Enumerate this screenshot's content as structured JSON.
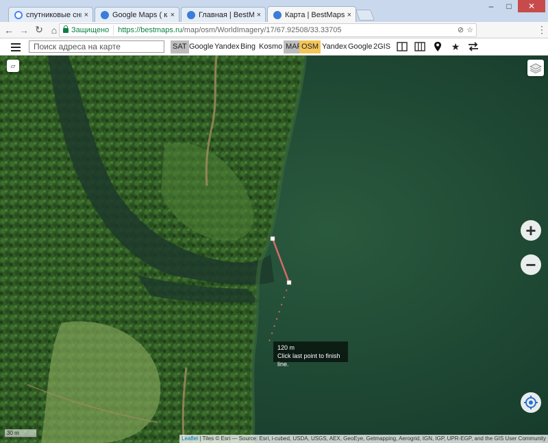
{
  "browser": {
    "tabs": [
      {
        "title": "спутниковые снимки - Г",
        "favicon_color": "#4285f4",
        "active": false
      },
      {
        "title": "Google Maps ( карты Go",
        "favicon_color": "#3b7dd8",
        "active": false
      },
      {
        "title": "Главная | BestMaps - спу",
        "favicon_color": "#3b7dd8",
        "active": false
      },
      {
        "title": "Карта | BestMaps - спут",
        "favicon_color": "#3b7dd8",
        "active": true
      }
    ],
    "close_glyph": "×",
    "secure_label": "Защищено",
    "url_host": "https://bestmaps.ru",
    "url_path": "/map/osm/WorldImagery/17/67.92508/33.33705"
  },
  "toolbar": {
    "search_placeholder": "Поиск адреса на карте",
    "sat_label": "SAT",
    "sat_providers": [
      "Google",
      "Yandex",
      "Bing",
      "Kosmo"
    ],
    "map_label": "MAP",
    "map_providers": [
      "OSM",
      "Yandex",
      "Google",
      "2GIS"
    ]
  },
  "map": {
    "measure_distance": "120 m",
    "measure_hint": "Click last point to finish line.",
    "scale_label": "30 m",
    "zoom_in": "+",
    "zoom_out": "−",
    "attribution_link": "Leaflet",
    "attribution_text": " | Tiles © Esri — Source: Esri, i-cubed, USDA, USGS, AEX, GeoEye, Getmapping, Aerogrid, IGN, IGP, UPR-EGP, and the GIS User Community"
  },
  "colors": {
    "accent_osm": "#f3c65a",
    "selected_gray": "#bdbdbd",
    "measure_line": "#d46a6a",
    "locate_blue": "#2a6fd6"
  }
}
